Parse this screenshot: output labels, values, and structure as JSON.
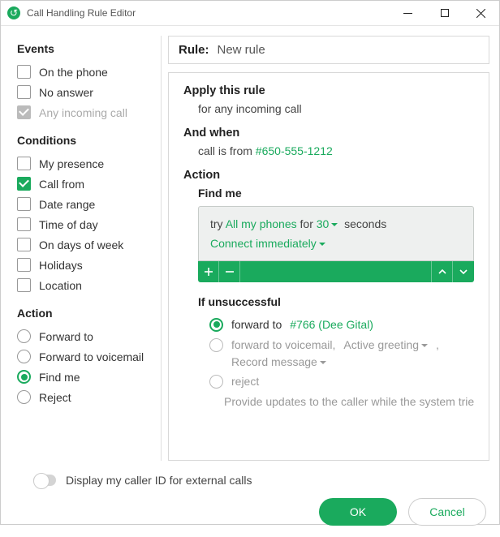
{
  "window": {
    "title": "Call Handling Rule Editor"
  },
  "sidebar": {
    "events": {
      "heading": "Events",
      "items": [
        {
          "label": "On the phone",
          "checked": false,
          "enabled": true
        },
        {
          "label": "No answer",
          "checked": false,
          "enabled": true
        },
        {
          "label": "Any incoming call",
          "checked": true,
          "enabled": false
        }
      ]
    },
    "conditions": {
      "heading": "Conditions",
      "items": [
        {
          "label": "My presence",
          "checked": false
        },
        {
          "label": "Call from",
          "checked": true
        },
        {
          "label": "Date range",
          "checked": false
        },
        {
          "label": "Time of day",
          "checked": false
        },
        {
          "label": "On days of week",
          "checked": false
        },
        {
          "label": "Holidays",
          "checked": false
        },
        {
          "label": "Location",
          "checked": false
        }
      ]
    },
    "action": {
      "heading": "Action",
      "items": [
        {
          "label": "Forward to",
          "checked": false
        },
        {
          "label": "Forward to voicemail",
          "checked": false
        },
        {
          "label": "Find me",
          "checked": true
        },
        {
          "label": "Reject",
          "checked": false
        }
      ]
    }
  },
  "rule": {
    "label": "Rule:",
    "name": "New rule",
    "apply": {
      "heading": "Apply this rule",
      "text": "for any incoming call"
    },
    "when": {
      "heading": "And when",
      "prefix": "call is from ",
      "number": "#650-555-1212"
    },
    "action": {
      "heading": "Action",
      "find_me": {
        "heading": "Find me",
        "try_word": "try",
        "phones": "All my phones",
        "for_word": "for",
        "seconds_value": "30",
        "seconds_word": "seconds",
        "connect": "Connect immediately"
      },
      "unsuccessful": {
        "heading": "If unsuccessful",
        "forward_to": {
          "label": "forward to",
          "target": "#766 (Dee Gital)"
        },
        "forward_vm": {
          "label": "forward to voicemail,",
          "greeting": "Active greeting",
          "record": "Record message"
        },
        "reject": "reject",
        "truncated": "Provide updates to the caller while the system trie"
      }
    }
  },
  "footer": {
    "toggle_label": "Display my caller ID for external calls",
    "ok": "OK",
    "cancel": "Cancel"
  }
}
